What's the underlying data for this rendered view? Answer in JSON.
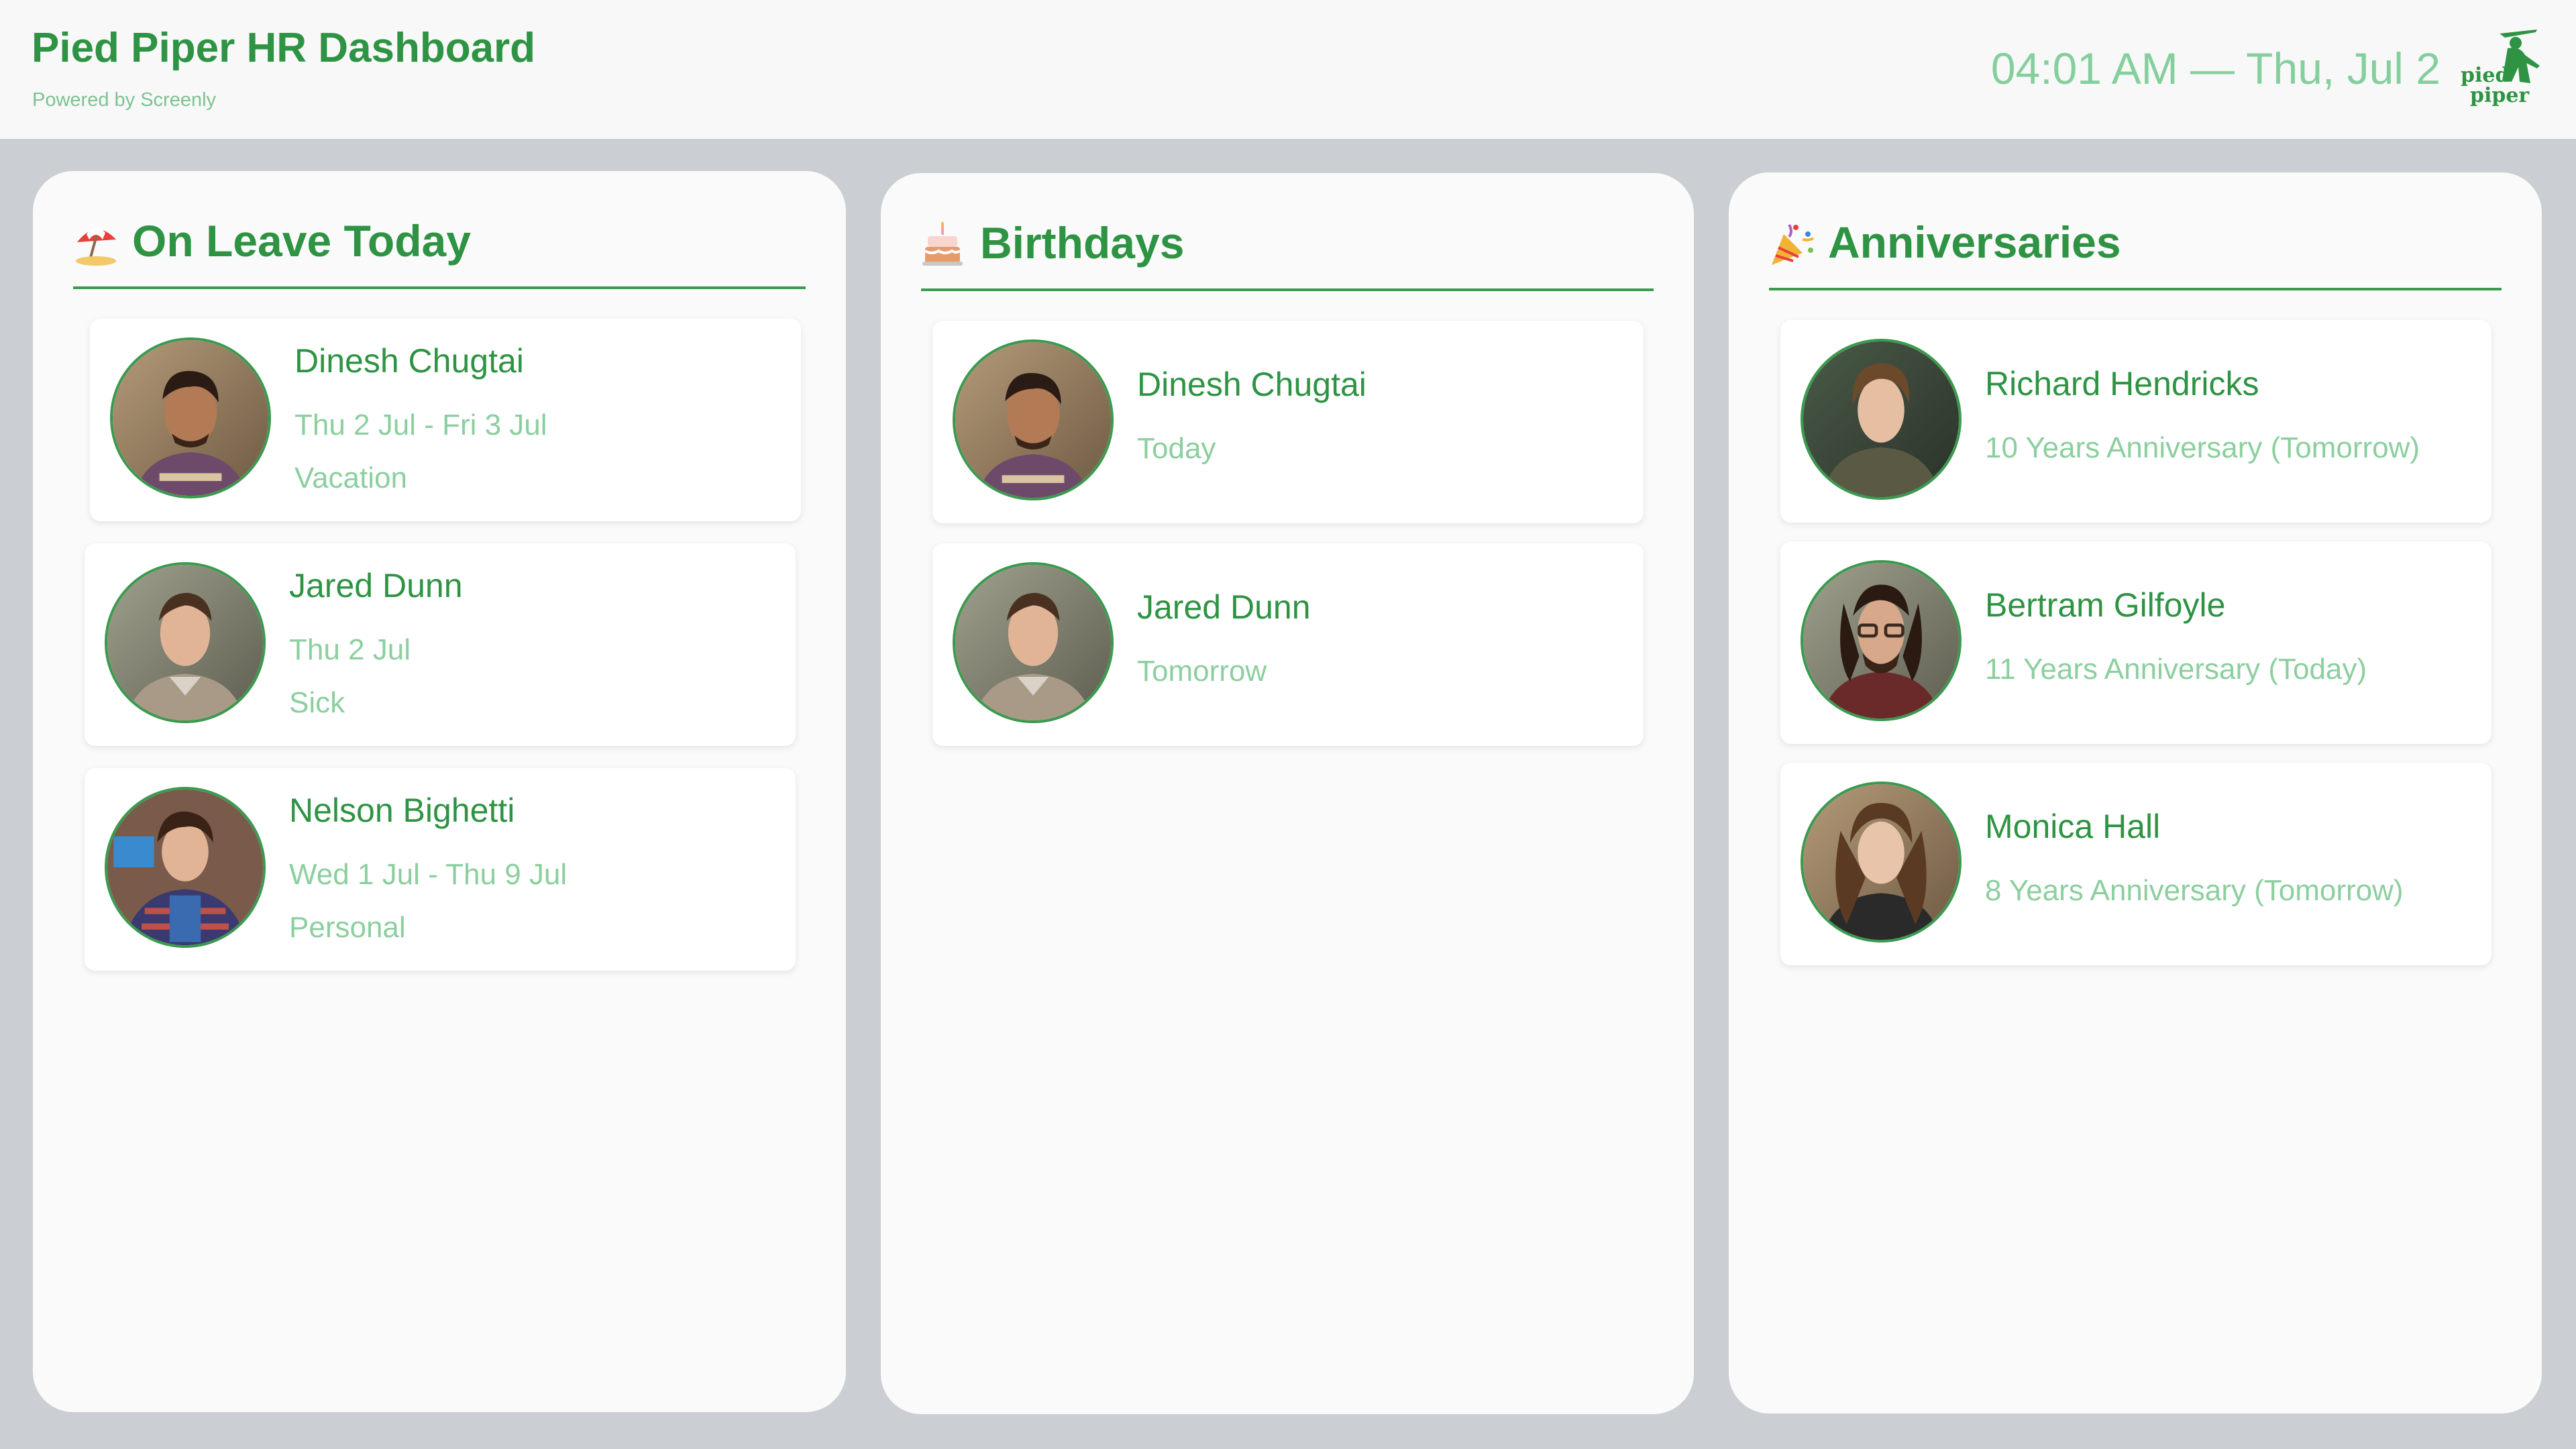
{
  "header": {
    "title": "Pied Piper HR Dashboard",
    "powered_by": "Powered by Screenly",
    "clock": "04:01 AM — Thu, Jul 2",
    "logo_line1": "pied",
    "logo_line2": "piper"
  },
  "colors": {
    "brand_green": "#2e9343",
    "muted_green": "#8ccf9f",
    "background": "#cbced2",
    "panel": "#fafafa"
  },
  "on_leave": {
    "title": "On Leave Today",
    "icon": "beach-umbrella-icon",
    "items": [
      {
        "name": "Dinesh Chugtai",
        "dates": "Thu 2 Jul - Fri 3 Jul",
        "reason": "Vacation"
      },
      {
        "name": "Jared Dunn",
        "dates": "Thu 2 Jul",
        "reason": "Sick"
      },
      {
        "name": "Nelson Bighetti",
        "dates": "Wed 1 Jul - Thu 9 Jul",
        "reason": "Personal"
      }
    ]
  },
  "birthdays": {
    "title": "Birthdays",
    "icon": "birthday-cake-icon",
    "items": [
      {
        "name": "Dinesh Chugtai",
        "when": "Today"
      },
      {
        "name": "Jared Dunn",
        "when": "Tomorrow"
      }
    ]
  },
  "anniversaries": {
    "title": "Anniversaries",
    "icon": "party-popper-icon",
    "items": [
      {
        "name": "Richard Hendricks",
        "detail": "10 Years Anniversary (Tomorrow)"
      },
      {
        "name": "Bertram Gilfoyle",
        "detail": "11 Years Anniversary (Today)"
      },
      {
        "name": "Monica Hall",
        "detail": "8 Years Anniversary (Tomorrow)"
      }
    ]
  }
}
